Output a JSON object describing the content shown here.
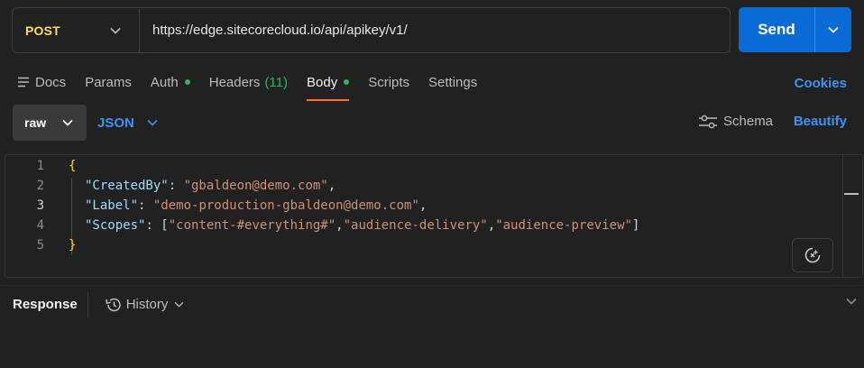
{
  "request": {
    "method": "POST",
    "url": "https://edge.sitecorecloud.io/api/apikey/v1/",
    "send_label": "Send"
  },
  "tabs": [
    {
      "label": "Docs",
      "icon": "docs-icon"
    },
    {
      "label": "Params"
    },
    {
      "label": "Auth",
      "indicator": true
    },
    {
      "label": "Headers",
      "count": "(11)"
    },
    {
      "label": "Body",
      "indicator": true,
      "active": true
    },
    {
      "label": "Scripts"
    },
    {
      "label": "Settings"
    }
  ],
  "cookies_label": "Cookies",
  "body_toolbar": {
    "mode": "raw",
    "format": "JSON",
    "schema_label": "Schema",
    "beautify_label": "Beautify"
  },
  "editor": {
    "line_numbers": [
      "1",
      "2",
      "3",
      "4",
      "5"
    ],
    "lines": {
      "l1": {
        "open": "{"
      },
      "l2": {
        "key": "\"CreatedBy\"",
        "sep": ": ",
        "value": "\"gbaldeon@demo.com\"",
        "end": ","
      },
      "l3": {
        "key": "\"Label\"",
        "sep": ": ",
        "value": "\"demo-production-gbaldeon@demo.com\"",
        "end": ","
      },
      "l4": {
        "key": "\"Scopes\"",
        "sep": ": [",
        "v1": "\"content-#everything#\"",
        "c1": ",",
        "v2": "\"audience-delivery\"",
        "c2": ",",
        "v3": "\"audience-preview\"",
        "close": "]"
      },
      "l5": {
        "close": "}"
      }
    }
  },
  "response": {
    "label": "Response",
    "history_label": "History"
  },
  "colors": {
    "background": "#212121",
    "accent_blue": "#0a6bd6",
    "link_blue": "#3b94f5",
    "method_yellow": "#ffd866",
    "active_tab_underline": "#ff6c37",
    "indicator_green": "#2fb45a",
    "json_key": "#9cdcfe",
    "json_string": "#ce9178"
  }
}
